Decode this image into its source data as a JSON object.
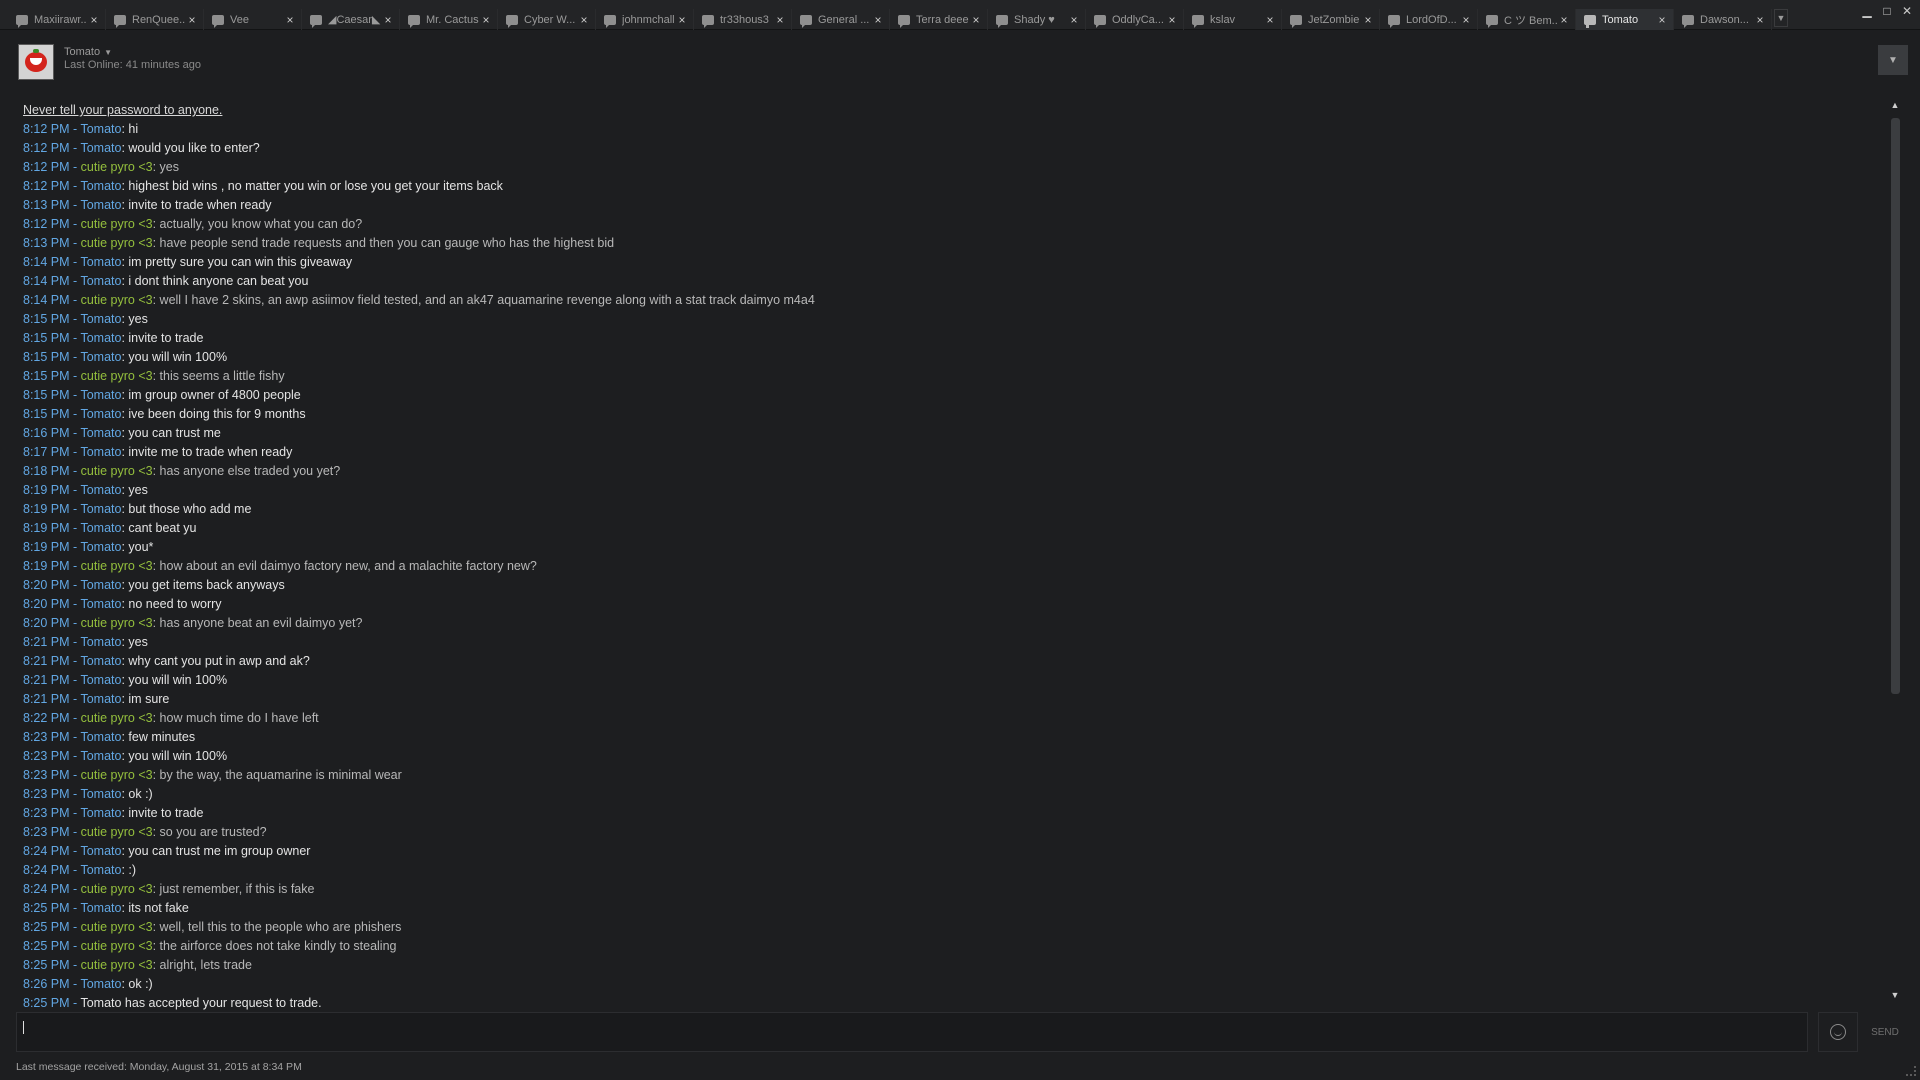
{
  "tabs": [
    {
      "label": "Maxiirawr...",
      "active": false
    },
    {
      "label": "RenQuee...",
      "active": false
    },
    {
      "label": "Vee",
      "active": false
    },
    {
      "label": "◢Caesar◣",
      "active": false
    },
    {
      "label": "Mr. Cactus",
      "active": false
    },
    {
      "label": "Cyber W...",
      "active": false
    },
    {
      "label": "johnmchall",
      "active": false
    },
    {
      "label": "tr33hous3",
      "active": false
    },
    {
      "label": "General ...",
      "active": false
    },
    {
      "label": "Terra deeer",
      "active": false
    },
    {
      "label": "Shady ♥",
      "active": false
    },
    {
      "label": "OddlyCa...",
      "active": false
    },
    {
      "label": "kslav",
      "active": false
    },
    {
      "label": "JetZombie",
      "active": false
    },
    {
      "label": "LordOfD...",
      "active": false
    },
    {
      "label": "C ツ Bem...",
      "active": false
    },
    {
      "label": "Tomato",
      "active": true
    },
    {
      "label": "Dawson...",
      "active": false
    }
  ],
  "header": {
    "friend_name": "Tomato",
    "last_online": "Last Online: 41 minutes ago"
  },
  "chat": {
    "warning": "Never tell your password to anyone.",
    "messages": [
      {
        "time": "8:12 PM",
        "sender": "Tomato",
        "text": "hi",
        "me": false
      },
      {
        "time": "8:12 PM",
        "sender": "Tomato",
        "text": "would you like to enter?",
        "me": false
      },
      {
        "time": "8:12 PM",
        "sender": "cutie pyro <3",
        "text": "yes",
        "me": true
      },
      {
        "time": "8:12 PM",
        "sender": "Tomato",
        "text": "highest bid wins , no matter you win or lose you get your items back",
        "me": false
      },
      {
        "time": "8:13 PM",
        "sender": "Tomato",
        "text": "invite to trade when ready",
        "me": false
      },
      {
        "time": "8:12 PM",
        "sender": "cutie pyro <3",
        "text": "actually, you know what you can do?",
        "me": true
      },
      {
        "time": "8:13 PM",
        "sender": "cutie pyro <3",
        "text": "have people send trade requests and then you can gauge who has the highest bid",
        "me": true
      },
      {
        "time": "8:14 PM",
        "sender": "Tomato",
        "text": "im pretty sure you can win this giveaway",
        "me": false
      },
      {
        "time": "8:14 PM",
        "sender": "Tomato",
        "text": "i dont think anyone can beat you",
        "me": false
      },
      {
        "time": "8:14 PM",
        "sender": "cutie pyro <3",
        "text": "well I have 2 skins, an awp asiimov field tested, and an ak47 aquamarine revenge along with a stat track daimyo m4a4",
        "me": true
      },
      {
        "time": "8:15 PM",
        "sender": "Tomato",
        "text": "yes",
        "me": false
      },
      {
        "time": "8:15 PM",
        "sender": "Tomato",
        "text": "invite to trade",
        "me": false
      },
      {
        "time": "8:15 PM",
        "sender": "Tomato",
        "text": "you will win 100%",
        "me": false
      },
      {
        "time": "8:15 PM",
        "sender": "cutie pyro <3",
        "text": "this seems a little fishy",
        "me": true
      },
      {
        "time": "8:15 PM",
        "sender": "Tomato",
        "text": "im group owner of 4800 people",
        "me": false
      },
      {
        "time": "8:15 PM",
        "sender": "Tomato",
        "text": "ive been doing this for 9 months",
        "me": false
      },
      {
        "time": "8:16 PM",
        "sender": "Tomato",
        "text": "you can trust me",
        "me": false
      },
      {
        "time": "8:17 PM",
        "sender": "Tomato",
        "text": "invite me to trade when ready",
        "me": false
      },
      {
        "time": "8:18 PM",
        "sender": "cutie pyro <3",
        "text": "has anyone else traded you yet?",
        "me": true
      },
      {
        "time": "8:19 PM",
        "sender": "Tomato",
        "text": "yes",
        "me": false
      },
      {
        "time": "8:19 PM",
        "sender": "Tomato",
        "text": "but those who add me",
        "me": false
      },
      {
        "time": "8:19 PM",
        "sender": "Tomato",
        "text": "cant beat yu",
        "me": false
      },
      {
        "time": "8:19 PM",
        "sender": "Tomato",
        "text": "you*",
        "me": false
      },
      {
        "time": "8:19 PM",
        "sender": "cutie pyro <3",
        "text": "how about an evil daimyo factory new, and a malachite factory new?",
        "me": true
      },
      {
        "time": "8:20 PM",
        "sender": "Tomato",
        "text": "you get items back anyways",
        "me": false
      },
      {
        "time": "8:20 PM",
        "sender": "Tomato",
        "text": "no need to worry",
        "me": false
      },
      {
        "time": "8:20 PM",
        "sender": "cutie pyro <3",
        "text": "has anyone beat an evil daimyo yet?",
        "me": true
      },
      {
        "time": "8:21 PM",
        "sender": "Tomato",
        "text": "yes",
        "me": false
      },
      {
        "time": "8:21 PM",
        "sender": "Tomato",
        "text": "why cant you put in awp and ak?",
        "me": false
      },
      {
        "time": "8:21 PM",
        "sender": "Tomato",
        "text": "you will win 100%",
        "me": false
      },
      {
        "time": "8:21 PM",
        "sender": "Tomato",
        "text": "im sure",
        "me": false
      },
      {
        "time": "8:22 PM",
        "sender": "cutie pyro <3",
        "text": "how much time do I have left",
        "me": true
      },
      {
        "time": "8:23 PM",
        "sender": "Tomato",
        "text": "few minutes",
        "me": false
      },
      {
        "time": "8:23 PM",
        "sender": "Tomato",
        "text": "you will win 100%",
        "me": false
      },
      {
        "time": "8:23 PM",
        "sender": "cutie pyro <3",
        "text": "by the way, the aquamarine is minimal wear",
        "me": true
      },
      {
        "time": "8:23 PM",
        "sender": "Tomato",
        "text": "ok :)",
        "me": false
      },
      {
        "time": "8:23 PM",
        "sender": "Tomato",
        "text": "invite to trade",
        "me": false
      },
      {
        "time": "8:23 PM",
        "sender": "cutie pyro <3",
        "text": "so you are trusted?",
        "me": true
      },
      {
        "time": "8:24 PM",
        "sender": "Tomato",
        "text": "you can trust me im group owner",
        "me": false
      },
      {
        "time": "8:24 PM",
        "sender": "Tomato",
        "text": ":)",
        "me": false
      },
      {
        "time": "8:24 PM",
        "sender": "cutie pyro <3",
        "text": "just remember, if this is fake",
        "me": true
      },
      {
        "time": "8:25 PM",
        "sender": "Tomato",
        "text": "its not fake",
        "me": false
      },
      {
        "time": "8:25 PM",
        "sender": "cutie pyro <3",
        "text": "well, tell this to the people who are phishers",
        "me": true
      },
      {
        "time": "8:25 PM",
        "sender": "cutie pyro <3",
        "text": "the airforce does not take kindly to stealing",
        "me": true
      },
      {
        "time": "8:25 PM",
        "sender": "cutie pyro <3",
        "text": "alright, lets trade",
        "me": true
      },
      {
        "time": "8:26 PM",
        "sender": "Tomato",
        "text": "ok :)",
        "me": false
      }
    ],
    "system_message": {
      "time": "8:25 PM",
      "text": "Tomato has accepted your request to trade."
    }
  },
  "input": {
    "value": "",
    "send_label": "SEND"
  },
  "status": {
    "text": "Last message received: Monday, August 31, 2015 at 8:34 PM"
  },
  "colors": {
    "friend": "#62a7e3",
    "self": "#94bf3d",
    "background": "#1d1e20"
  }
}
